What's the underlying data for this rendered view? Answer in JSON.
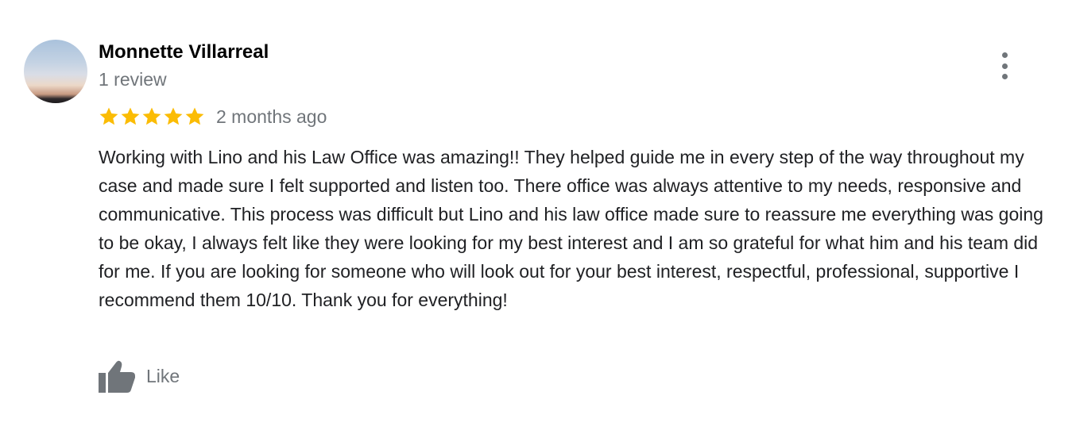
{
  "review": {
    "author": "Monnette Villarreal",
    "review_count": "1 review",
    "rating": 5,
    "rating_max": 5,
    "time": "2 months ago",
    "text": "Working with Lino and his Law Office was amazing!! They helped guide me in every step of the way throughout my case and made sure I felt supported and listen too. There office was always attentive to my needs, responsive and communicative. This process was difficult but Lino and his law office made sure to reassure me everything was going to be okay, I always felt like they were looking for my best interest and I am so grateful for what him and his team did for me. If you are looking for someone who will look out for your best interest, respectful, professional, supportive I recommend them 10/10. Thank you for everything!",
    "like_label": "Like"
  },
  "icons": {
    "menu": "more-vert-icon",
    "star": "star-icon",
    "like": "thumbs-up-icon"
  },
  "colors": {
    "star": "#fbbc04",
    "secondary_text": "#70757a",
    "body_text": "#202124",
    "author_text": "#000000"
  }
}
